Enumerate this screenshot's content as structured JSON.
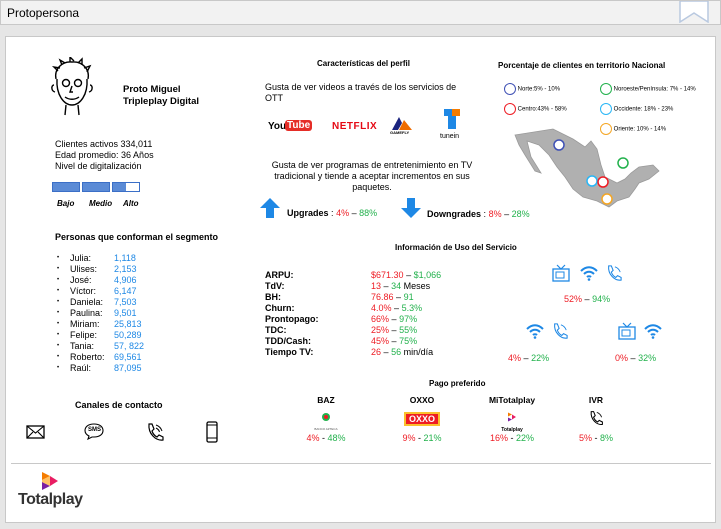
{
  "window": {
    "title": "Protopersona"
  },
  "persona": {
    "name_line1": "Proto Miguel",
    "name_line2": "Tripleplay Digital",
    "active_clients": "Clientes activos 334,011",
    "avg_age": "Edad promedio: 36 Años",
    "digital_level_label": "Nivel de digitalización",
    "digital_level": {
      "value": 2.5,
      "max": 3
    },
    "scale": [
      "Bajo",
      "Medio",
      "Alto"
    ]
  },
  "segment": {
    "title": "Personas que conforman el segmento",
    "people": [
      {
        "name": "Julia:",
        "value": "1,118"
      },
      {
        "name": "Ulises:",
        "value": "2,153"
      },
      {
        "name": "José:",
        "value": "4,906"
      },
      {
        "name": "Víctor:",
        "value": "6,147"
      },
      {
        "name": "Daniela:",
        "value": "7,503"
      },
      {
        "name": "Paulina:",
        "value": "9,501"
      },
      {
        "name": "Miriam:",
        "value": "25,813"
      },
      {
        "name": "Felipe:",
        "value": "50,289"
      },
      {
        "name": "Tania:",
        "value": "57, 822"
      },
      {
        "name": "Roberto:",
        "value": "69,561"
      },
      {
        "name": "Raúl:",
        "value": "87,095"
      }
    ]
  },
  "contact": {
    "title": "Canales de contacto",
    "icons": [
      "envelope-icon",
      "sms-icon",
      "phone-icon",
      "mobile-icon"
    ],
    "sms_text": "SMS"
  },
  "profile": {
    "title": "Características del perfil",
    "ott_text": "Gusta de ver videos a través de los servicios de OTT",
    "logos": {
      "youtube_a": "You",
      "youtube_b": "Tube",
      "netflix": "NETFLIX",
      "gamefly": "GAMEFLY",
      "tunein": "tunein"
    },
    "tv_text": "Gusta de ver programas de entretenimiento en TV tradicional y tiende a aceptar incrementos en sus paquetes.",
    "upgrades_label": "Upgrades",
    "upgrades_low": "4%",
    "upgrades_high": "88%",
    "downgrades_label": "Downgrades",
    "downgrades_low": "8%",
    "downgrades_high": "28%",
    "sep": ":",
    "dash": "–"
  },
  "territory": {
    "title": "Porcentaje de clientes en territorio Nacional",
    "regions": [
      {
        "label": "Norte:5% - 10%",
        "color": "#3f51b5"
      },
      {
        "label": "Noroeste/Península: 7% - 14%",
        "color": "#22b14c"
      },
      {
        "label": "Centro:43% - 58%",
        "color": "#ee1c24"
      },
      {
        "label": "Occidente: 18% - 23%",
        "color": "#29b6f6"
      },
      {
        "label": "Oriente: 10% - 14%",
        "color": "#f5a623"
      }
    ]
  },
  "usage": {
    "title": "Información de Uso del Servicio",
    "metrics": [
      {
        "label": "ARPU:",
        "low": "$671.30",
        "high": "$1,066",
        "unit": ""
      },
      {
        "label": "TdV:",
        "low": "13",
        "high": "34",
        "unit": "Meses"
      },
      {
        "label": "BH:",
        "low": "76.86",
        "high": "91",
        "unit": ""
      },
      {
        "label": "Churn:",
        "low": "4.0%",
        "high": "5.3%",
        "unit": ""
      },
      {
        "label": "Prontopago:",
        "low": "66%",
        "high": "97%",
        "unit": ""
      },
      {
        "label": "TDC:",
        "low": "25%",
        "high": "55%",
        "unit": ""
      },
      {
        "label": "TDD/Cash:",
        "low": "45%",
        "high": "75%",
        "unit": ""
      },
      {
        "label": "Tiempo TV:",
        "low": "26",
        "high": "56",
        "unit": "min/día"
      }
    ],
    "triple": {
      "low": "52%",
      "high": "94%"
    },
    "net_phone": {
      "low": "4%",
      "high": "22%"
    },
    "tv_net": {
      "low": "0%",
      "high": "32%"
    }
  },
  "payment": {
    "title": "Pago preferido",
    "methods": [
      {
        "name": "BAZ",
        "low": "4%",
        "high": "48%",
        "logo_text": "BANCO AZTECA"
      },
      {
        "name": "OXXO",
        "low": "9%",
        "high": "21%",
        "logo_text": "OXXO"
      },
      {
        "name": "MiTotalplay",
        "low": "16%",
        "high": "22%",
        "logo_text": "Totalplay"
      },
      {
        "name": "IVR",
        "low": "5%",
        "high": "8%",
        "logo_text": ""
      }
    ]
  },
  "footer": {
    "brand": "Totalplay"
  }
}
